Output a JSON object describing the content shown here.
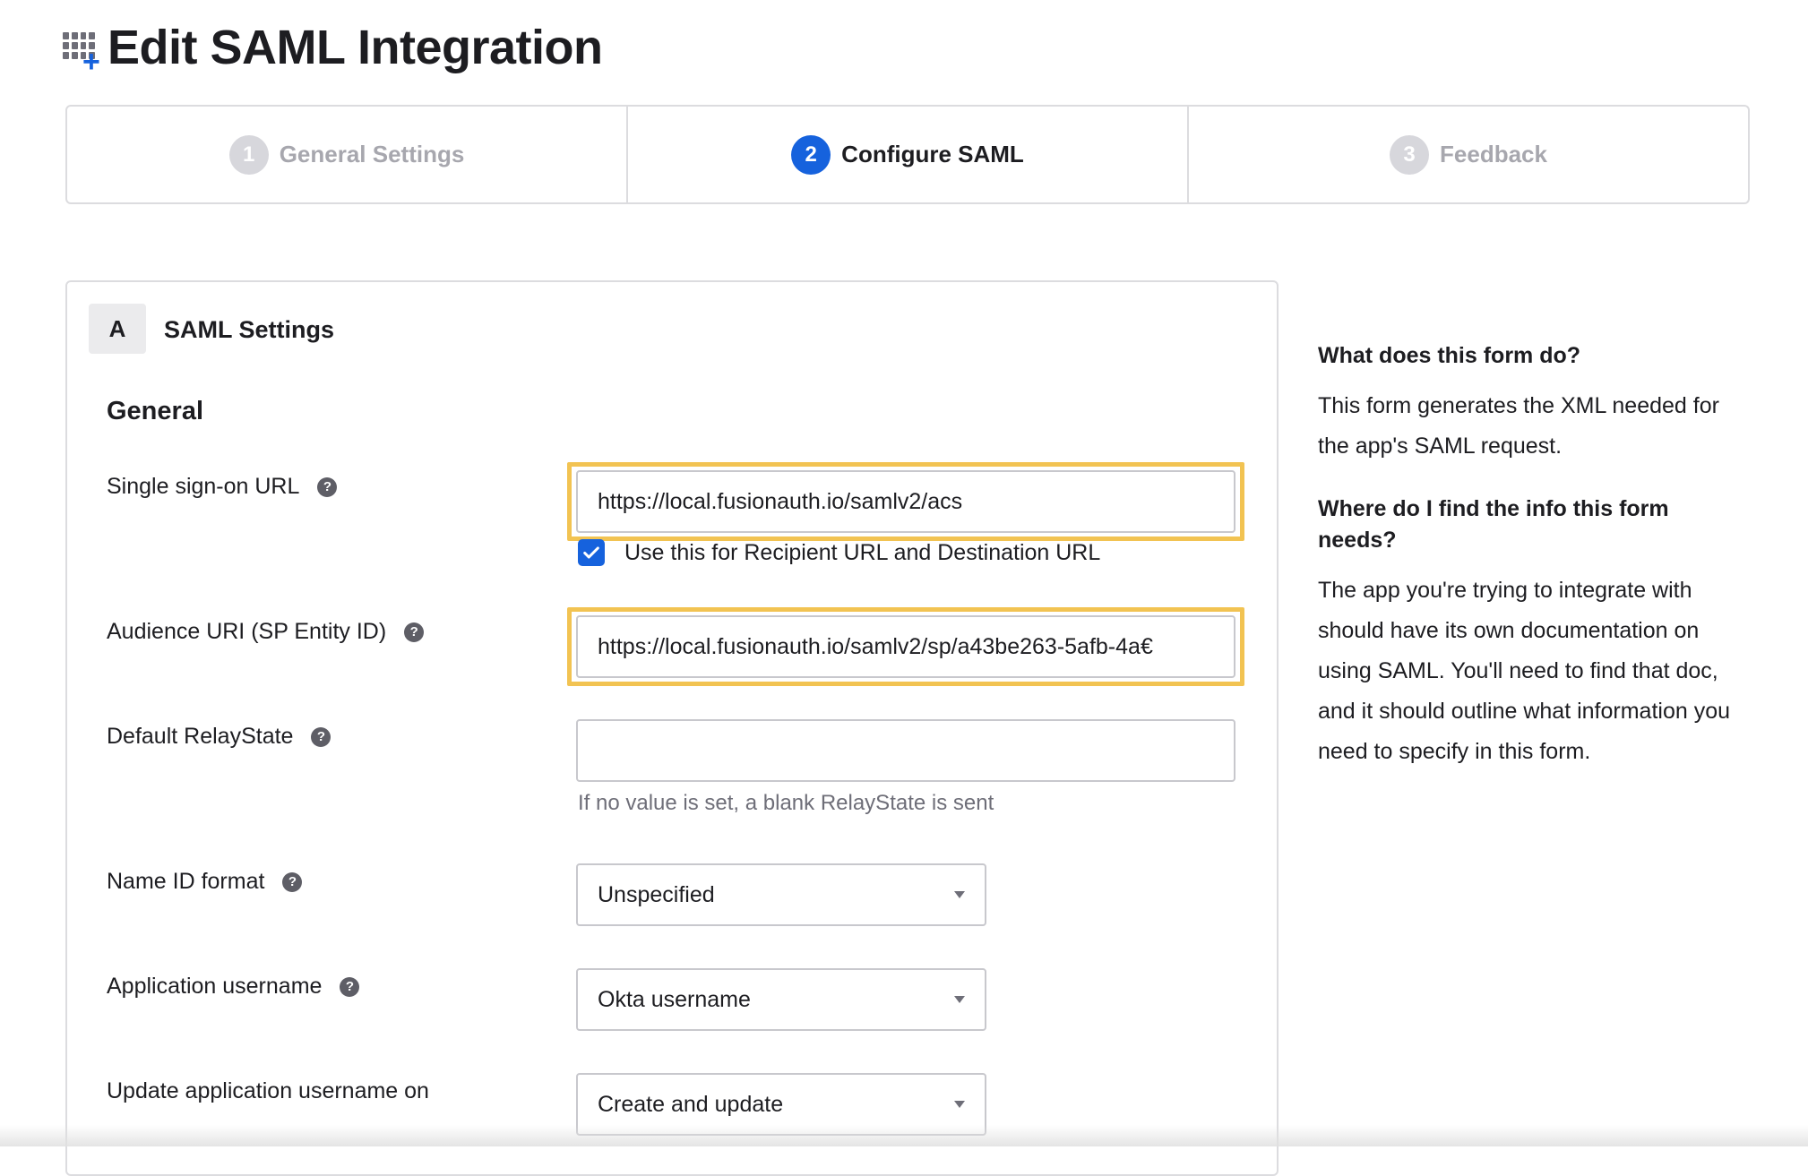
{
  "header": {
    "title": "Edit SAML Integration",
    "icon": "app-add-icon"
  },
  "wizard": {
    "steps": [
      {
        "number": "1",
        "label": "General Settings",
        "state": "inactive"
      },
      {
        "number": "2",
        "label": "Configure SAML",
        "state": "active"
      },
      {
        "number": "3",
        "label": "Feedback",
        "state": "inactive"
      }
    ]
  },
  "section": {
    "badge": "A",
    "title": "SAML Settings",
    "group": "General"
  },
  "fields": {
    "sso_url": {
      "label": "Single sign-on URL",
      "value": "https://local.fusionauth.io/samlv2/acs"
    },
    "recipient_checkbox": {
      "label": "Use this for Recipient URL and Destination URL",
      "checked": true
    },
    "audience_uri": {
      "label": "Audience URI (SP Entity ID)",
      "value": "https://local.fusionauth.io/samlv2/sp/a43be263-5afb-4a€"
    },
    "relay_state": {
      "label": "Default RelayState",
      "value": "",
      "hint": "If no value is set, a blank RelayState is sent"
    },
    "name_id_format": {
      "label": "Name ID format",
      "value": "Unspecified"
    },
    "app_username": {
      "label": "Application username",
      "value": "Okta username"
    },
    "update_username_on": {
      "label": "Update application username on",
      "value": "Create and update"
    }
  },
  "sidebar": {
    "q1": "What does this form do?",
    "a1": "This form generates the XML needed for the app's SAML request.",
    "q2": "Where do I find the info this form needs?",
    "a2": "The app you're trying to integrate with should have its own documentation on using SAML. You'll need to find that doc, and it should outline what information you need to specify in this form."
  },
  "colors": {
    "accent": "#1662dd",
    "highlight": "#f2c352"
  }
}
